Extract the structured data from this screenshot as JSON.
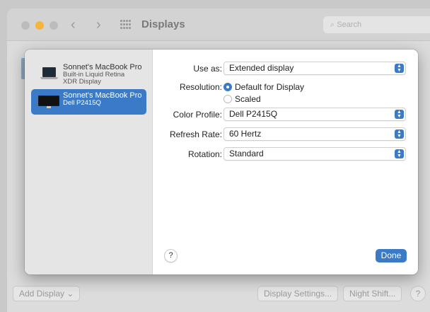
{
  "window": {
    "title": "Displays",
    "search_placeholder": "Search"
  },
  "sidebar": {
    "displays": [
      {
        "name": "Sonnet's MacBook Pro",
        "subtitle_line1": "Built-in Liquid Retina",
        "subtitle_line2": "XDR Display",
        "icon": "laptop-icon",
        "selected": false
      },
      {
        "name": "Sonnet's MacBook Pro",
        "subtitle_line1": "Dell P2415Q",
        "icon": "monitor-icon",
        "selected": true
      }
    ]
  },
  "settings": {
    "use_as": {
      "label": "Use as:",
      "value": "Extended display"
    },
    "resolution": {
      "label": "Resolution:",
      "options": [
        {
          "label": "Default for Display",
          "selected": true
        },
        {
          "label": "Scaled",
          "selected": false
        }
      ]
    },
    "color_profile": {
      "label": "Color Profile:",
      "value": "Dell P2415Q"
    },
    "refresh_rate": {
      "label": "Refresh Rate:",
      "value": "60 Hertz"
    },
    "rotation": {
      "label": "Rotation:",
      "value": "Standard"
    }
  },
  "sheet_buttons": {
    "help": "?",
    "done": "Done"
  },
  "bottom_bar": {
    "add_display": "Add Display",
    "display_settings": "Display Settings...",
    "night_shift": "Night Shift...",
    "help": "?"
  },
  "colors": {
    "accent": "#3a7ac7",
    "selected_row": "#3a7ac7"
  }
}
